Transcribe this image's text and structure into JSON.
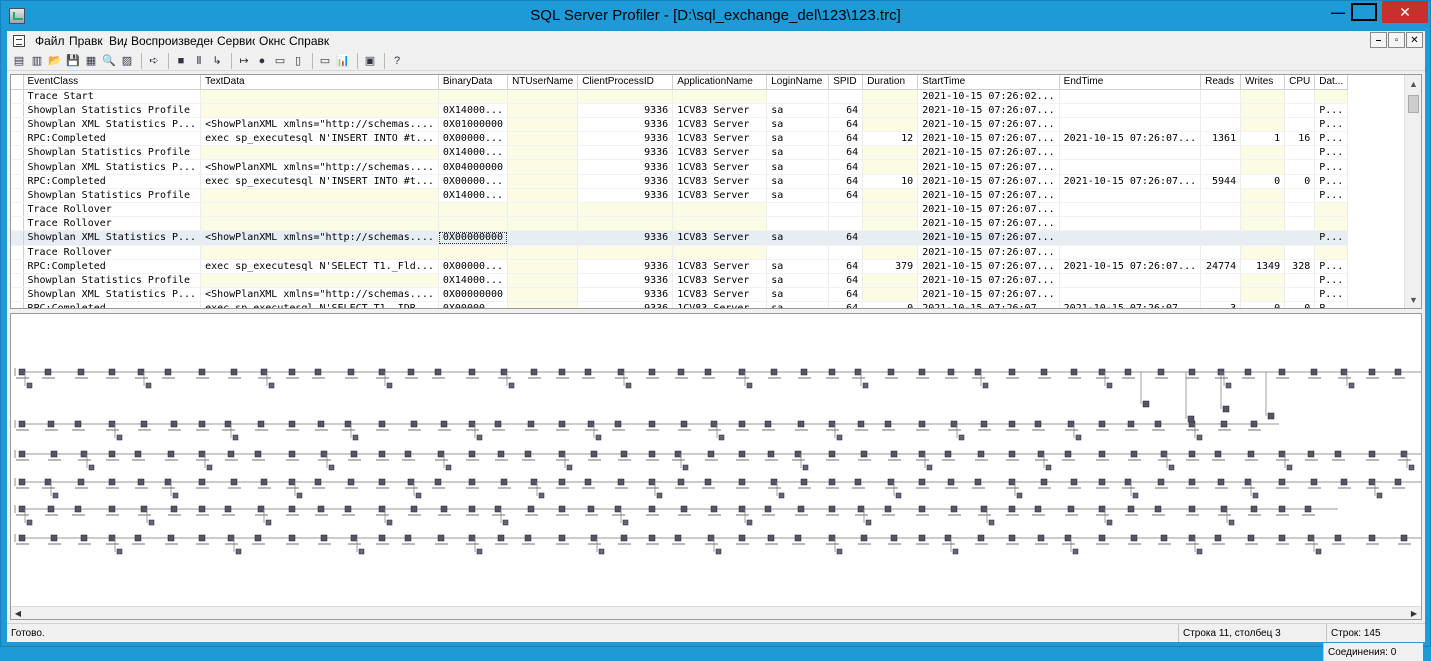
{
  "window": {
    "title": "SQL Server Profiler - [D:\\sql_exchange_del\\123\\123.trc]",
    "minimize": "—",
    "restore": "❐",
    "close": "✕"
  },
  "menubar": {
    "items": [
      "Файл",
      "Правк",
      "Вид",
      "Воспроизведение",
      "Сервис",
      "Окно",
      "Справка"
    ],
    "mdi_min": "–",
    "mdi_restore": "▫",
    "mdi_close": "✕"
  },
  "toolbar": {
    "icons": [
      "new-trace-icon",
      "new-template-icon",
      "open-icon",
      "save-icon",
      "properties-icon",
      "find-icon",
      "clear-icon",
      "start-replay-icon",
      "stop-icon",
      "pause-icon",
      "step-icon",
      "run-to-cursor-icon",
      "toggle-breakpoint-icon",
      "template-properties-icon",
      "trace-properties-icon",
      "clear-window-icon",
      "perfmon-icon",
      "activity-monitor-icon",
      "help-icon"
    ],
    "glyphs": [
      "▤",
      "▥",
      "📂",
      "💾",
      "▦",
      "🔍",
      "▨",
      "➪",
      "■",
      "Ⅱ",
      "↳",
      "↦",
      "●",
      "▭",
      "▯",
      "▭",
      "📊",
      "▣",
      "?"
    ]
  },
  "grid": {
    "columns": [
      "EventClass",
      "TextData",
      "BinaryData",
      "NTUserName",
      "ClientProcessID",
      "ApplicationName",
      "LoginName",
      "SPID",
      "Duration",
      "StartTime",
      "EndTime",
      "Reads",
      "Writes",
      "CPU",
      "Dat..."
    ],
    "rows": [
      [
        "Trace Start",
        "",
        "",
        "",
        "",
        "",
        "",
        "",
        "",
        "2021-10-15 07:26:02...",
        "",
        "",
        "",
        "",
        ""
      ],
      [
        "Showplan Statistics Profile",
        "",
        "0X14000...",
        "",
        "9336",
        "1CV83 Server",
        "sa",
        "64",
        "",
        "2021-10-15 07:26:07...",
        "",
        "",
        "",
        "",
        "P..."
      ],
      [
        "Showplan XML Statistics P...",
        "<ShowPlanXML xmlns=\"http://schemas....",
        "0X01000000",
        "",
        "9336",
        "1CV83 Server",
        "sa",
        "64",
        "",
        "2021-10-15 07:26:07...",
        "",
        "",
        "",
        "",
        "P..."
      ],
      [
        "RPC:Completed",
        "exec sp_executesql N'INSERT INTO #t...",
        "0X00000...",
        "",
        "9336",
        "1CV83 Server",
        "sa",
        "64",
        "12",
        "2021-10-15 07:26:07...",
        "2021-10-15 07:26:07...",
        "1361",
        "1",
        "16",
        "P..."
      ],
      [
        "Showplan Statistics Profile",
        "",
        "0X14000...",
        "",
        "9336",
        "1CV83 Server",
        "sa",
        "64",
        "",
        "2021-10-15 07:26:07...",
        "",
        "",
        "",
        "",
        "P..."
      ],
      [
        "Showplan XML Statistics P...",
        "<ShowPlanXML xmlns=\"http://schemas....",
        "0X04000000",
        "",
        "9336",
        "1CV83 Server",
        "sa",
        "64",
        "",
        "2021-10-15 07:26:07...",
        "",
        "",
        "",
        "",
        "P..."
      ],
      [
        "RPC:Completed",
        "exec sp_executesql N'INSERT INTO #t...",
        "0X00000...",
        "",
        "9336",
        "1CV83 Server",
        "sa",
        "64",
        "10",
        "2021-10-15 07:26:07...",
        "2021-10-15 07:26:07...",
        "5944",
        "0",
        "0",
        "P..."
      ],
      [
        "Showplan Statistics Profile",
        "",
        "0X14000...",
        "",
        "9336",
        "1CV83 Server",
        "sa",
        "64",
        "",
        "2021-10-15 07:26:07...",
        "",
        "",
        "",
        "",
        "P..."
      ],
      [
        "Trace Rollover",
        "",
        "",
        "",
        "",
        "",
        "",
        "",
        "",
        "2021-10-15 07:26:07...",
        "",
        "",
        "",
        "",
        ""
      ],
      [
        "Trace Rollover",
        "",
        "",
        "",
        "",
        "",
        "",
        "",
        "",
        "2021-10-15 07:26:07...",
        "",
        "",
        "",
        "",
        ""
      ],
      [
        "Showplan XML Statistics P...",
        "<ShowPlanXML xmlns=\"http://schemas....",
        "0X00000000",
        "",
        "9336",
        "1CV83 Server",
        "sa",
        "64",
        "",
        "2021-10-15 07:26:07...",
        "",
        "",
        "",
        "",
        "P..."
      ],
      [
        "Trace Rollover",
        "",
        "",
        "",
        "",
        "",
        "",
        "",
        "",
        "2021-10-15 07:26:07...",
        "",
        "",
        "",
        "",
        ""
      ],
      [
        "RPC:Completed",
        "exec sp_executesql N'SELECT T1._Fld...",
        "0X00000...",
        "",
        "9336",
        "1CV83 Server",
        "sa",
        "64",
        "379",
        "2021-10-15 07:26:07...",
        "2021-10-15 07:26:07...",
        "24774",
        "1349",
        "328",
        "P..."
      ],
      [
        "Showplan Statistics Profile",
        "",
        "0X14000...",
        "",
        "9336",
        "1CV83 Server",
        "sa",
        "64",
        "",
        "2021-10-15 07:26:07...",
        "",
        "",
        "",
        "",
        "P..."
      ],
      [
        "Showplan XML Statistics P...",
        "<ShowPlanXML xmlns=\"http://schemas....",
        "0X00000000",
        "",
        "9336",
        "1CV83 Server",
        "sa",
        "64",
        "",
        "2021-10-15 07:26:07...",
        "",
        "",
        "",
        "",
        "P..."
      ],
      [
        "RPC:Completed",
        "exec sp_executesql N'SELECT T1._IDR...",
        "0X00000...",
        "",
        "9336",
        "1CV83 Server",
        "sa",
        "64",
        "0",
        "2021-10-15 07:26:07...",
        "2021-10-15 07:26:07...",
        "3",
        "0",
        "0",
        "P..."
      ]
    ],
    "selected_row": 10
  },
  "statusbar": {
    "ready": "Готово.",
    "position": "Строка 11, столбец 3",
    "rows": "Строк: 145",
    "connections": "Соединения: 0"
  }
}
